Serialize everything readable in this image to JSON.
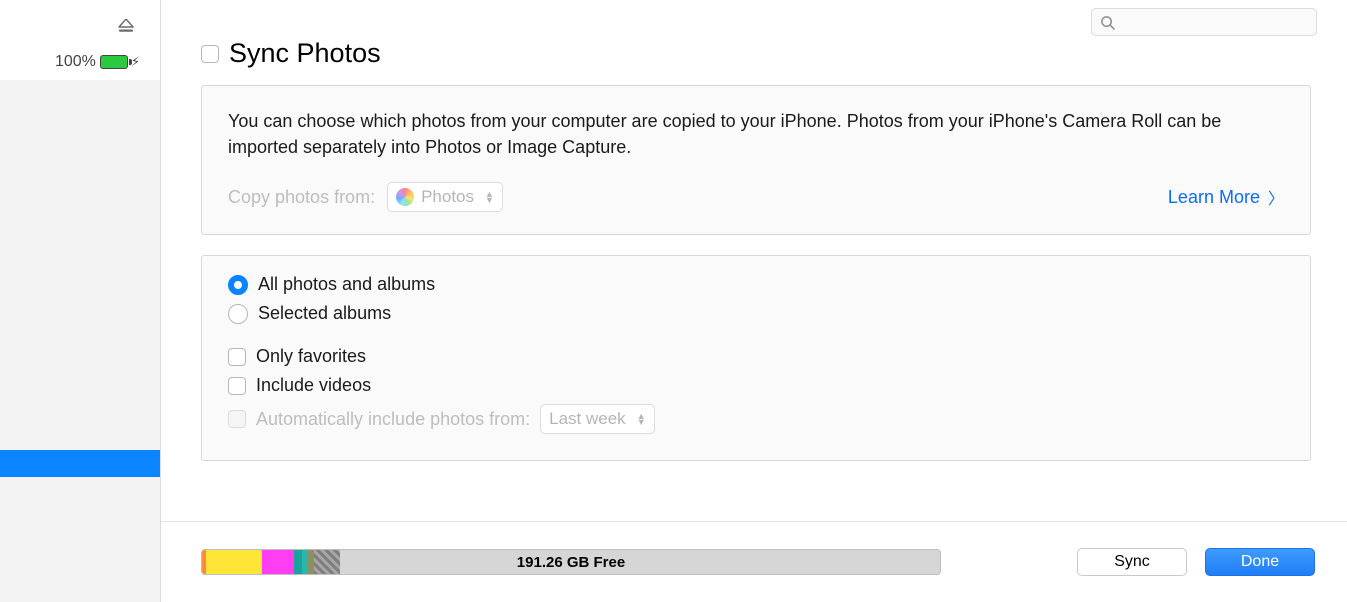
{
  "sidebar": {
    "battery_percent": "100%"
  },
  "search": {
    "placeholder": ""
  },
  "heading": {
    "title": "Sync Photos"
  },
  "info": {
    "text": "You can choose which photos from your computer are copied to your iPhone. Photos from your iPhone's Camera Roll can be imported separately into Photos or Image Capture.",
    "copy_label": "Copy photos from:",
    "copy_source": "Photos",
    "learn_more": "Learn More"
  },
  "options": {
    "all_label": "All photos and albums",
    "selected_label": "Selected albums",
    "favorites_label": "Only favorites",
    "videos_label": "Include videos",
    "auto_label": "Automatically include photos from:",
    "auto_value": "Last week"
  },
  "footer": {
    "free_label": "191.26 GB Free",
    "sync_label": "Sync",
    "done_label": "Done"
  }
}
